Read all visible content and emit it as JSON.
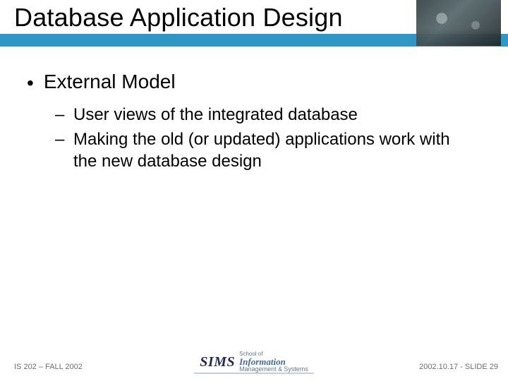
{
  "title": "Database Application Design",
  "bullets": {
    "l1": "External Model",
    "sub": [
      "User views of the integrated database",
      "Making the old (or updated) applications work with the new database design"
    ]
  },
  "footer": {
    "left": "IS 202 – FALL 2002",
    "right": "2002.10.17 - SLIDE 29",
    "logo": {
      "mark": "SIMS",
      "line1": "School of",
      "line2": "Information",
      "line3_prefix": "Management",
      "line3_amp": "&",
      "line3_suffix": "Systems"
    }
  }
}
